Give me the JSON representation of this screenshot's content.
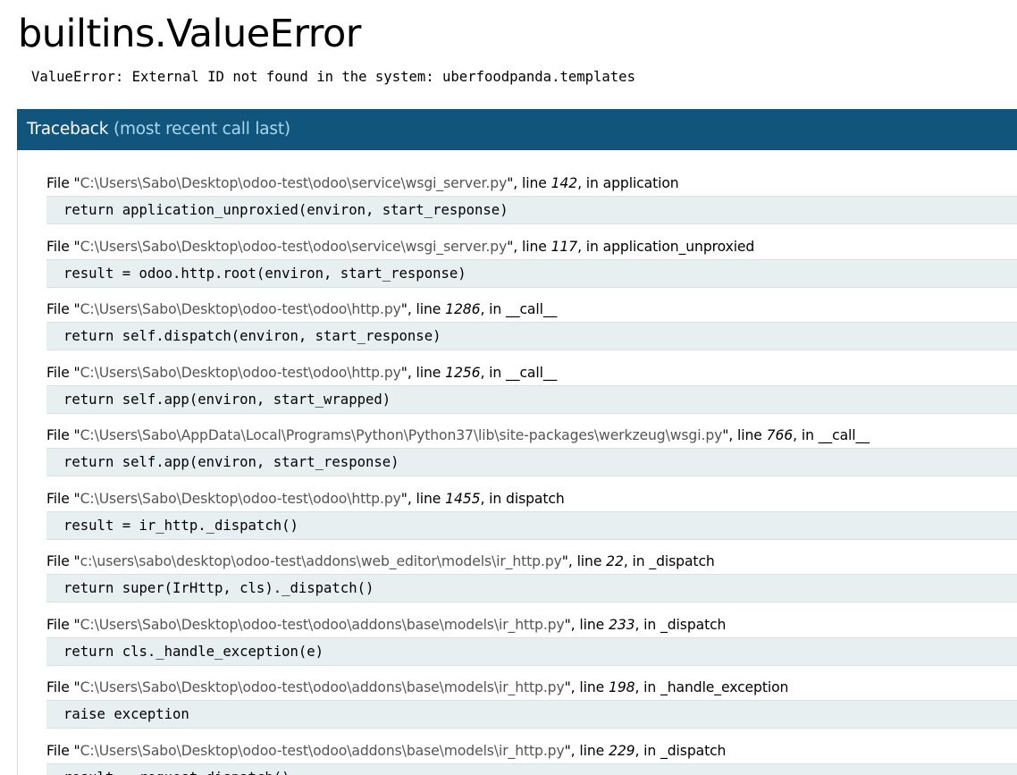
{
  "page": {
    "title": "builtins.ValueError",
    "error_message": "ValueError: External ID not found in the system: uberfoodpanda.templates"
  },
  "traceback": {
    "header_label": "Traceback",
    "header_sub": "(most recent call last)",
    "frames": [
      {
        "prefix": "File \"",
        "filename": "C:\\Users\\Sabo\\Desktop\\odoo-test\\odoo\\service\\wsgi_server.py",
        "mid": "\", line ",
        "lineno": "142",
        "func_prefix": ", in ",
        "func": "application",
        "code": "return application_unproxied(environ, start_response)"
      },
      {
        "prefix": "File \"",
        "filename": "C:\\Users\\Sabo\\Desktop\\odoo-test\\odoo\\service\\wsgi_server.py",
        "mid": "\", line ",
        "lineno": "117",
        "func_prefix": ", in ",
        "func": "application_unproxied",
        "code": "result = odoo.http.root(environ, start_response)"
      },
      {
        "prefix": "File \"",
        "filename": "C:\\Users\\Sabo\\Desktop\\odoo-test\\odoo\\http.py",
        "mid": "\", line ",
        "lineno": "1286",
        "func_prefix": ", in ",
        "func": "__call__",
        "code": "return self.dispatch(environ, start_response)"
      },
      {
        "prefix": "File \"",
        "filename": "C:\\Users\\Sabo\\Desktop\\odoo-test\\odoo\\http.py",
        "mid": "\", line ",
        "lineno": "1256",
        "func_prefix": ", in ",
        "func": "__call__",
        "code": "return self.app(environ, start_wrapped)"
      },
      {
        "prefix": "File \"",
        "filename": "C:\\Users\\Sabo\\AppData\\Local\\Programs\\Python\\Python37\\lib\\site-packages\\werkzeug\\wsgi.py",
        "mid": "\", line ",
        "lineno": "766",
        "func_prefix": ", in ",
        "func": "__call__",
        "code": "return self.app(environ, start_response)"
      },
      {
        "prefix": "File \"",
        "filename": "C:\\Users\\Sabo\\Desktop\\odoo-test\\odoo\\http.py",
        "mid": "\", line ",
        "lineno": "1455",
        "func_prefix": ", in ",
        "func": "dispatch",
        "code": "result = ir_http._dispatch()"
      },
      {
        "prefix": "File \"",
        "filename": "c:\\users\\sabo\\desktop\\odoo-test\\addons\\web_editor\\models\\ir_http.py",
        "mid": "\", line ",
        "lineno": "22",
        "func_prefix": ", in ",
        "func": "_dispatch",
        "code": "return super(IrHttp, cls)._dispatch()"
      },
      {
        "prefix": "File \"",
        "filename": "C:\\Users\\Sabo\\Desktop\\odoo-test\\odoo\\addons\\base\\models\\ir_http.py",
        "mid": "\", line ",
        "lineno": "233",
        "func_prefix": ", in ",
        "func": "_dispatch",
        "code": "return cls._handle_exception(e)"
      },
      {
        "prefix": "File \"",
        "filename": "C:\\Users\\Sabo\\Desktop\\odoo-test\\odoo\\addons\\base\\models\\ir_http.py",
        "mid": "\", line ",
        "lineno": "198",
        "func_prefix": ", in ",
        "func": "_handle_exception",
        "code": "raise exception"
      },
      {
        "prefix": "File \"",
        "filename": "C:\\Users\\Sabo\\Desktop\\odoo-test\\odoo\\addons\\base\\models\\ir_http.py",
        "mid": "\", line ",
        "lineno": "229",
        "func_prefix": ", in ",
        "func": "_dispatch",
        "code": "result = request.dispatch()"
      }
    ]
  },
  "colors": {
    "header_bg": "#11557c",
    "header_sub_text": "#a7d8ef",
    "code_bg": "#e8eff0",
    "filename_text": "#555555"
  }
}
